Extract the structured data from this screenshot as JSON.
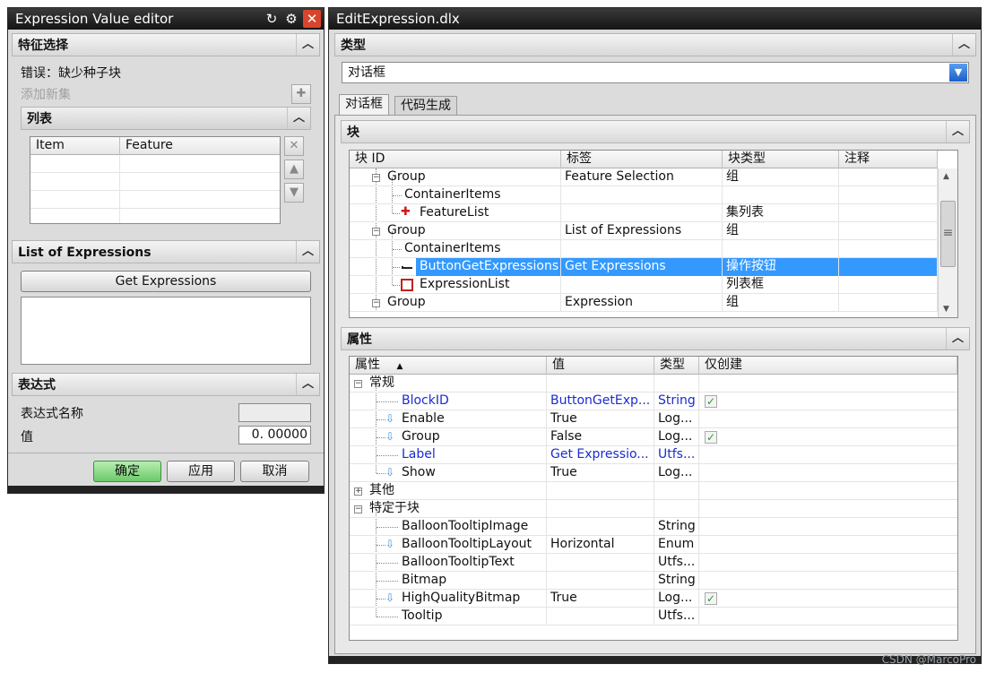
{
  "left_window": {
    "title": "Expression Value editor",
    "feature_section": {
      "header": "特征选择",
      "error_text": "错误：缺少种子块",
      "add_new_set": "添加新集",
      "list_header": "列表",
      "columns": [
        "Item",
        "Feature"
      ]
    },
    "expressions_section": {
      "header": "List of Expressions",
      "button": "Get Expressions"
    },
    "expression_section": {
      "header": "表达式",
      "name_label": "表达式名称",
      "value_label": "值",
      "value": "0. 00000"
    },
    "buttons": {
      "ok": "确定",
      "apply": "应用",
      "cancel": "取消"
    }
  },
  "right_window": {
    "title": "EditExpression.dlx",
    "type_section": {
      "header": "类型",
      "selected": "对话框"
    },
    "tabs": [
      "对话框",
      "代码生成"
    ],
    "block_section": {
      "header": "块",
      "columns": [
        "块 ID",
        "标签",
        "块类型",
        "注释"
      ],
      "rows": [
        {
          "id": "Group",
          "label": "Feature Selection",
          "type": "组",
          "note": ""
        },
        {
          "id": "ContainerItems",
          "label": "",
          "type": "",
          "note": ""
        },
        {
          "id": "FeatureList",
          "label": "",
          "type": "集列表",
          "note": ""
        },
        {
          "id": "Group",
          "label": "List of Expressions",
          "type": "组",
          "note": ""
        },
        {
          "id": "ContainerItems",
          "label": "",
          "type": "",
          "note": ""
        },
        {
          "id": "ButtonGetExpressions",
          "label": "Get Expressions",
          "type": "操作按钮",
          "note": ""
        },
        {
          "id": "ExpressionList",
          "label": "",
          "type": "列表框",
          "note": ""
        },
        {
          "id": "Group",
          "label": "Expression",
          "type": "组",
          "note": ""
        }
      ]
    },
    "property_section": {
      "header": "属性",
      "columns": [
        "属性",
        "值",
        "类型",
        "仅创建"
      ],
      "rows": [
        {
          "name": "常规",
          "value": "",
          "type": ""
        },
        {
          "name": "BlockID",
          "value": "ButtonGetExp...",
          "type": "String"
        },
        {
          "name": "Enable",
          "value": "True",
          "type": "Log..."
        },
        {
          "name": "Group",
          "value": "False",
          "type": "Log..."
        },
        {
          "name": "Label",
          "value": "Get Expressio...",
          "type": "Utfs..."
        },
        {
          "name": "Show",
          "value": "True",
          "type": "Log..."
        },
        {
          "name": "其他",
          "value": "",
          "type": ""
        },
        {
          "name": "特定于块",
          "value": "",
          "type": ""
        },
        {
          "name": "BalloonTooltipImage",
          "value": "",
          "type": "String"
        },
        {
          "name": "BalloonTooltipLayout",
          "value": "Horizontal",
          "type": "Enum"
        },
        {
          "name": "BalloonTooltipText",
          "value": "",
          "type": "Utfs..."
        },
        {
          "name": "Bitmap",
          "value": "",
          "type": "String"
        },
        {
          "name": "HighQualityBitmap",
          "value": "True",
          "type": "Log..."
        },
        {
          "name": "Tooltip",
          "value": "",
          "type": "Utfs..."
        }
      ]
    }
  },
  "watermark": "CSDN @MarcoPro",
  "colors": {
    "selection": "#3399ff",
    "highlight_text": "#1a2bd0",
    "ok_button": "#7fd17f"
  }
}
